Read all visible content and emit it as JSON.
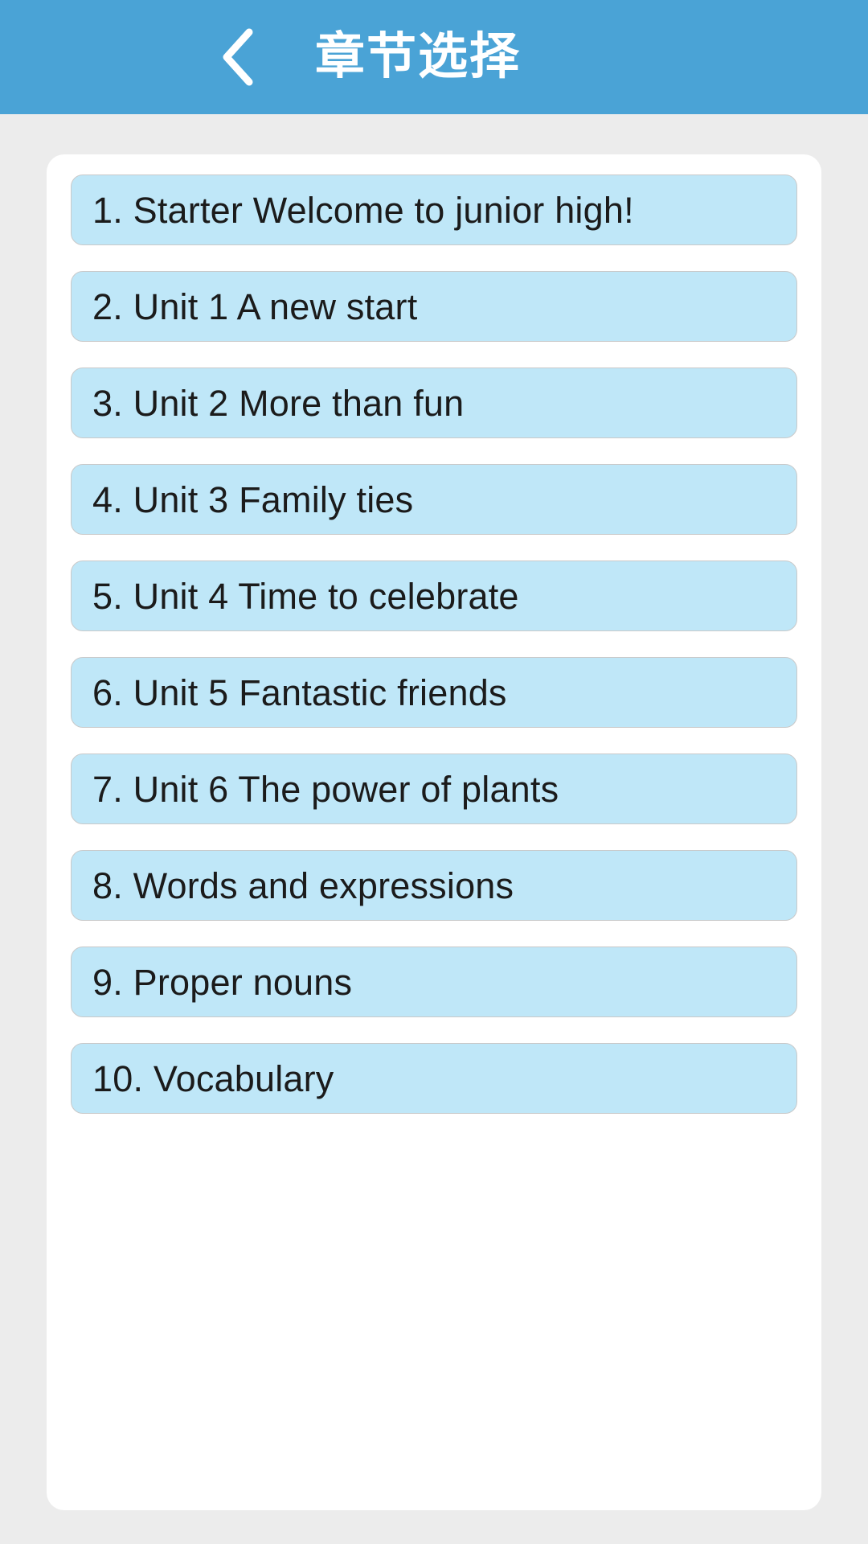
{
  "header": {
    "title": "章节选择",
    "back_icon": "chevron-left-icon",
    "background_color": "#4aa3d6",
    "title_color": "#ffffff"
  },
  "page": {
    "background_color": "#ececec",
    "card_color": "#ffffff"
  },
  "chapters": {
    "item_fill_color": "#bfe7f8",
    "item_border_color": "#c9c9c9",
    "item_text_color": "#1b1b1b",
    "items": [
      {
        "label": "1. Starter Welcome to junior high!"
      },
      {
        "label": "2. Unit 1 A new start"
      },
      {
        "label": "3. Unit 2 More than fun"
      },
      {
        "label": "4. Unit 3 Family ties"
      },
      {
        "label": "5. Unit 4 Time to celebrate"
      },
      {
        "label": "6. Unit 5 Fantastic friends"
      },
      {
        "label": "7. Unit 6 The power of plants"
      },
      {
        "label": "8. Words and expressions"
      },
      {
        "label": "9. Proper nouns"
      },
      {
        "label": "10. Vocabulary"
      }
    ]
  }
}
